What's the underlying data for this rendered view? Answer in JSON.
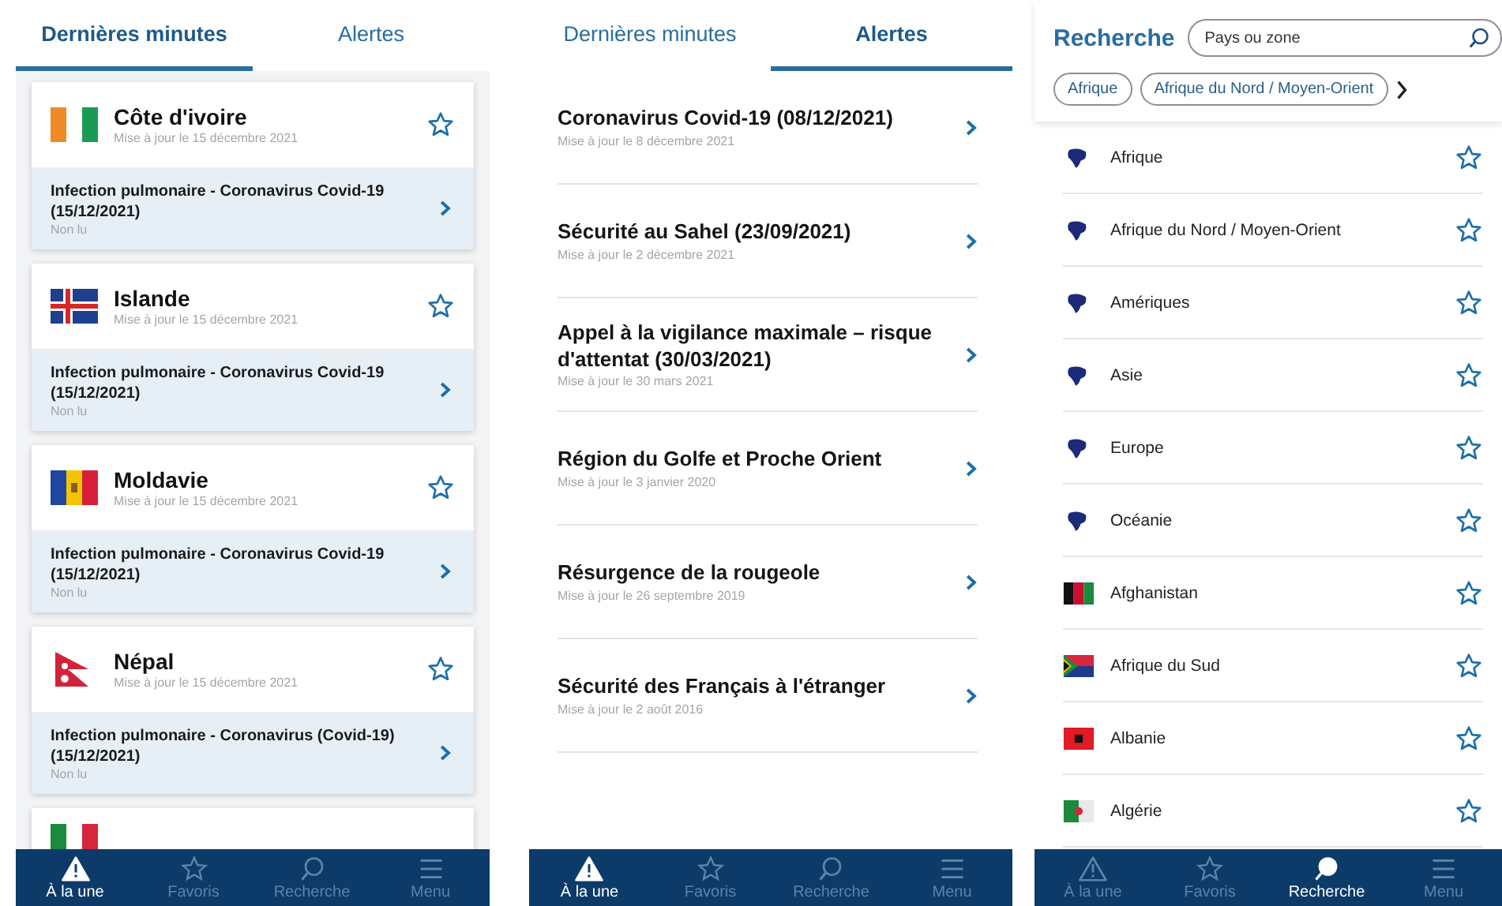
{
  "screen_latest": {
    "tabs": [
      {
        "label": "Dernières minutes",
        "selected": true
      },
      {
        "label": "Alertes",
        "selected": false
      }
    ],
    "cards": [
      {
        "country": "Côte d'ivoire",
        "updated": "Mise à jour le 15 décembre 2021",
        "favorite": false,
        "alert": "Infection pulmonaire - Coronavirus Covid-19 (15/12/2021)",
        "status": "Non lu"
      },
      {
        "country": "Islande",
        "updated": "Mise à jour le 15 décembre 2021",
        "favorite": false,
        "alert": "Infection pulmonaire - Coronavirus Covid-19 (15/12/2021)",
        "status": "Non lu"
      },
      {
        "country": "Moldavie",
        "updated": "Mise à jour le 15 décembre 2021",
        "favorite": false,
        "alert": "Infection pulmonaire - Coronavirus Covid-19 (15/12/2021)",
        "status": "Non lu"
      },
      {
        "country": "Népal",
        "updated": "Mise à jour le 15 décembre 2021",
        "favorite": false,
        "alert": "Infection pulmonaire - Coronavirus (Covid-19) (15/12/2021)",
        "status": "Non lu"
      }
    ],
    "nav": [
      {
        "kind": "alert",
        "label": "À la une",
        "selected": true
      },
      {
        "kind": "star",
        "label": "Favoris",
        "selected": false
      },
      {
        "kind": "search",
        "label": "Recherche",
        "selected": false
      },
      {
        "kind": "menu",
        "label": "Menu",
        "selected": false
      }
    ]
  },
  "screen_alerts": {
    "tabs": [
      {
        "label": "Dernières minutes",
        "selected": false
      },
      {
        "label": "Alertes",
        "selected": true
      }
    ],
    "alerts": [
      {
        "title": "Coronavirus Covid-19 (08/12/2021)",
        "updated": "Mise à jour le 8 décembre 2021"
      },
      {
        "title": "Sécurité au Sahel (23/09/2021)",
        "updated": "Mise à jour le 2 décembre 2021"
      },
      {
        "title": "Appel à la vigilance maximale – risque d'attentat (30/03/2021)",
        "updated": "Mise à jour le 30 mars 2021"
      },
      {
        "title": "Région du Golfe et Proche Orient",
        "updated": "Mise à jour le 3 janvier 2020"
      },
      {
        "title": "Résurgence de la rougeole",
        "updated": "Mise à jour le 26 septembre 2019"
      },
      {
        "title": "Sécurité des Français à l'étranger",
        "updated": "Mise à jour le 2 août 2016"
      }
    ],
    "nav": [
      {
        "kind": "alert",
        "label": "À la une",
        "selected": true
      },
      {
        "kind": "star",
        "label": "Favoris",
        "selected": false
      },
      {
        "kind": "search",
        "label": "Recherche",
        "selected": false
      },
      {
        "kind": "menu",
        "label": "Menu",
        "selected": false
      }
    ]
  },
  "screen_search": {
    "title": "Recherche",
    "search": {
      "placeholder": "Pays ou zone"
    },
    "chips": [
      "Afrique",
      "Afrique du Nord / Moyen-Orient"
    ],
    "results": [
      {
        "name": "Afrique",
        "favorite": false
      },
      {
        "name": "Afrique du Nord / Moyen-Orient",
        "favorite": false
      },
      {
        "name": "Amériques",
        "favorite": false
      },
      {
        "name": "Asie",
        "favorite": false
      },
      {
        "name": "Europe",
        "favorite": false
      },
      {
        "name": "Océanie",
        "favorite": false
      },
      {
        "name": "Afghanistan",
        "favorite": false
      },
      {
        "name": "Afrique du Sud",
        "favorite": false
      },
      {
        "name": "Albanie",
        "favorite": false
      },
      {
        "name": "Algérie",
        "favorite": false
      }
    ],
    "nav": [
      {
        "kind": "alert",
        "label": "À la une",
        "selected": false
      },
      {
        "kind": "star",
        "label": "Favoris",
        "selected": false
      },
      {
        "kind": "search",
        "label": "Recherche",
        "selected": true
      },
      {
        "kind": "menu",
        "label": "Menu",
        "selected": false
      }
    ]
  }
}
